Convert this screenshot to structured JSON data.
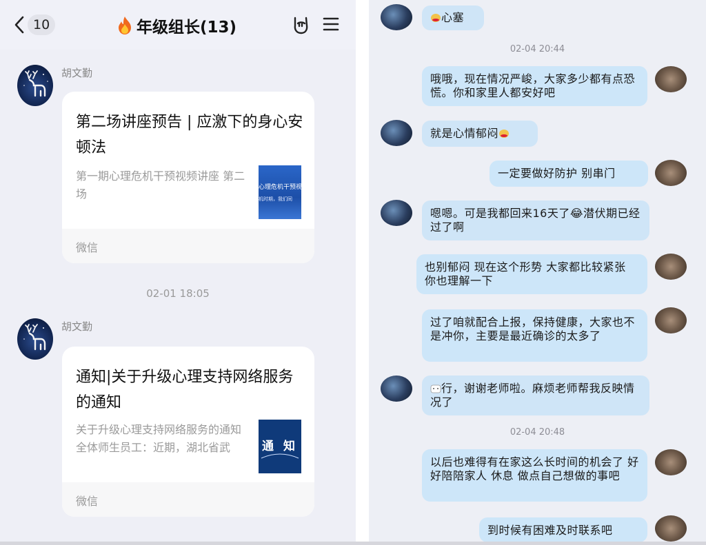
{
  "left": {
    "header": {
      "back_count": "10",
      "title": "年级组长(13)"
    },
    "messages": [
      {
        "sender": "胡文勤",
        "card_title": "第二场讲座预告 | 应激下的身心安顿法",
        "card_desc": "第一期心理危机干预视频讲座 第二场",
        "thumb_text": [
          "心理危机干预视",
          "机时期，我们同"
        ],
        "source": "微信"
      },
      {
        "sender": "胡文勤",
        "card_title": "通知|关于升级心理支持网络服务的通知",
        "card_desc": "关于升级心理支持网络服务的通知 全体师生员工：近期，湖北省武汉...",
        "thumb_text": [
          "通",
          "知"
        ],
        "source": "微信"
      }
    ],
    "timestamp": "02-01 18:05"
  },
  "right": {
    "bubbles": [
      {
        "text": "心塞",
        "side": "in"
      },
      {
        "text": "哦哦，现在情况严峻，大家多少都有点恐慌。你和家里人都安好吧",
        "side": "out"
      },
      {
        "text": "就是心情郁闷",
        "side": "in"
      },
      {
        "text": "一定要做好防护 别串门",
        "side": "out"
      },
      {
        "text": "嗯嗯。可是我都回来16天了😂潜伏期已经过了啊",
        "side": "in"
      },
      {
        "text": "也别郁闷 现在这个形势 大家都比较紧张 你也理解一下",
        "side": "out"
      },
      {
        "text": "过了咱就配合上报，保持健康，大家也不是冲你，主要是最近确诊的太多了",
        "side": "out"
      },
      {
        "text": "行，谢谢老师啦。麻烦老师帮我反映情况了",
        "side": "in"
      },
      {
        "text": "以后也难得有在家这么长时间的机会了 好好陪陪家人 休息 做点自己想做的事吧",
        "side": "out"
      },
      {
        "text": "到时候有困难及时联系吧",
        "side": "out"
      }
    ],
    "timestamps": [
      "02-04 20:44",
      "02-04 20:48"
    ]
  }
}
